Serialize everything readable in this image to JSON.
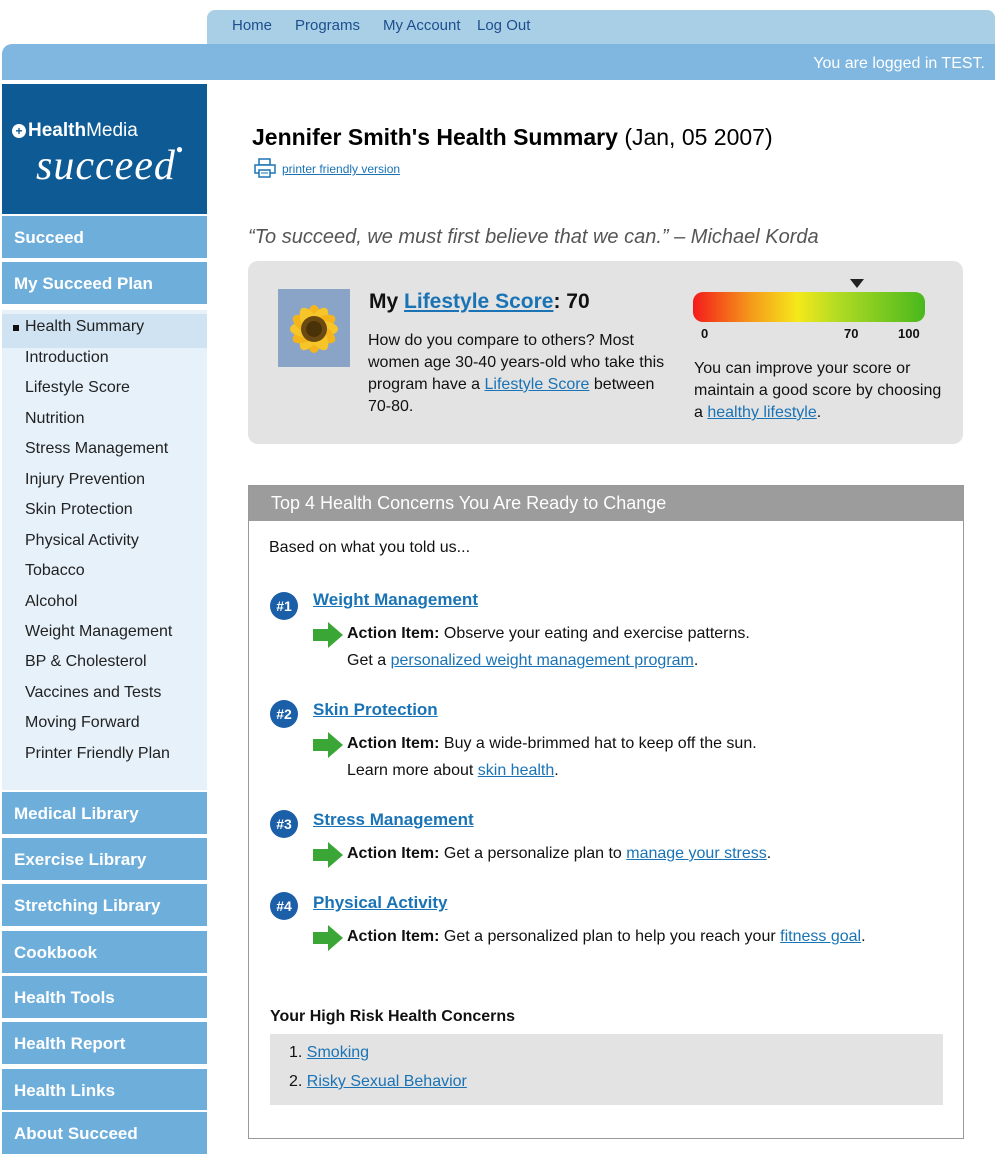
{
  "topnav": {
    "home": "Home",
    "programs": "Programs",
    "my_account": "My Account",
    "log_out": "Log Out"
  },
  "login_status": "You are logged in TEST.",
  "logo": {
    "brand_bold": "Health",
    "brand_light": "Media",
    "product": "succeed"
  },
  "sidebar": {
    "succeed": "Succeed",
    "my_plan": "My Succeed Plan",
    "sub_items": [
      "Health Summary",
      "Introduction",
      "Lifestyle Score",
      "Nutrition",
      "Stress Management",
      "Injury Prevention",
      "Skin Protection",
      "Physical Activity",
      "Tobacco",
      "Alcohol",
      "Weight Management",
      "BP & Cholesterol",
      "Vaccines and Tests",
      "Moving Forward",
      "Printer Friendly Plan"
    ],
    "sections": [
      "Medical Library",
      "Exercise Library",
      "Stretching Library",
      "Cookbook",
      "Health Tools",
      "Health Report",
      "Health Links",
      "About Succeed"
    ]
  },
  "summary": {
    "title": "Jennifer Smith's Health Summary",
    "date": "(Jan, 05 2007)",
    "printer_link": "printer friendly version",
    "quote": "“To succeed, we must first believe that we can.” – Michael Korda"
  },
  "score": {
    "prefix": "My",
    "link": "Lifestyle Score",
    "value_label": ": 70",
    "text_before": "How do you compare to others? Most women age 30-40 years-old who take this program have a",
    "text_link": "Lifestyle Score",
    "text_after": "between 70-80.",
    "gauge_value": 70,
    "gauge_min": "0",
    "gauge_mid": "70",
    "gauge_max": "100",
    "improve_text": "You can improve your score or maintain a good score by choosing a",
    "improve_link": "healthy lifestyle",
    "improve_end": "."
  },
  "concerns": {
    "heading": "Top 4 Health Concerns You Are Ready to Change",
    "intro": "Based on what you told us...",
    "items": [
      {
        "num": "#1",
        "title": "Weight Management",
        "action_label": "Action Item:",
        "action": "Observe your eating and exercise patterns.",
        "line2_before": "Get a",
        "line2_link": "personalized weight management program",
        "line2_after": "."
      },
      {
        "num": "#2",
        "title": "Skin Protection",
        "action_label": "Action Item:",
        "action": "Buy a wide-brimmed hat to keep off the sun.",
        "line2_before": "Learn more about",
        "line2_link": "skin health",
        "line2_after": "."
      },
      {
        "num": "#3",
        "title": "Stress Management",
        "action_label": "Action Item:",
        "action": "Get a personalize plan to",
        "action_link": "manage your stress",
        "action_end": "."
      },
      {
        "num": "#4",
        "title": "Physical Activity",
        "action_label": "Action Item:",
        "action": "Get a personalized plan to help you reach your",
        "action_link": "fitness goal",
        "action_end": "."
      }
    ]
  },
  "high_risk": {
    "title": "Your High Risk Health Concerns",
    "items": [
      {
        "num": "1.",
        "label": "Smoking"
      },
      {
        "num": "2.",
        "label": "Risky Sexual Behavior"
      }
    ]
  },
  "colors": {
    "nav_dark": "#0d5a95",
    "nav_button": "#6eaedb",
    "link": "#1a73b5",
    "badge": "#1a5fa8",
    "arrow": "#3aa635"
  }
}
